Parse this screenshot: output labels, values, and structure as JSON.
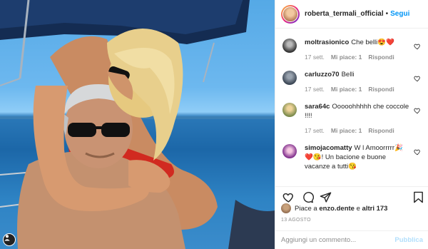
{
  "post": {
    "username": "roberta_termali_official",
    "separator": "•",
    "follow_label": "Segui"
  },
  "comments": [
    {
      "user": "moltrasionico",
      "text": "Che belli😍❤️",
      "time": "17 sett.",
      "likes": "Mi piace: 1",
      "reply": "Rispondi"
    },
    {
      "user": "carluzzo70",
      "text": "Belli",
      "time": "17 sett.",
      "likes": "Mi piace: 1",
      "reply": "Rispondi"
    },
    {
      "user": "sara64c",
      "text": "Ooooohhhhh che coccole !!!!",
      "time": "17 sett.",
      "likes": "Mi piace: 1",
      "reply": "Rispondi"
    },
    {
      "user": "simojacomatty",
      "text": "W l Amoorrrrr🎉❤️😘! Un bacione e buone vacanze a tutti😘",
      "time": "",
      "likes": "",
      "reply": ""
    }
  ],
  "likes": {
    "prefix": "Piace a",
    "user": "enzo.dente",
    "mid": "e",
    "others": "altri 173"
  },
  "date": "13 AGOSTO",
  "add_comment": {
    "placeholder": "Aggiungi un commento...",
    "publish_label": "Pubblica"
  },
  "icons": {
    "like": "heart-icon",
    "comment": "comment-icon",
    "share": "share-icon",
    "save": "bookmark-icon"
  },
  "colors": {
    "accent": "#0095f6",
    "publish_disabled": "#b2dffc",
    "muted": "#8e8e8e"
  }
}
